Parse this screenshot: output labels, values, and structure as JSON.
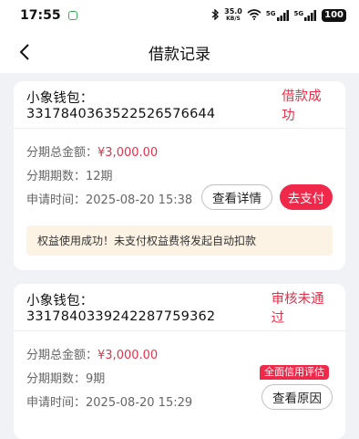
{
  "status_bar": {
    "time": "17:55",
    "net_speed_value": "35.0",
    "net_speed_unit": "KB/S",
    "signal_1": "5G",
    "signal_2": "5G",
    "battery": "100"
  },
  "nav": {
    "title": "借款记录"
  },
  "records": [
    {
      "title": "小象钱包：3317840363522526576644",
      "status": "借款成功",
      "total_label": "分期总金额：",
      "total_value": "¥3,000.00",
      "periods": "分期期数：12期",
      "apply_time": "申请时间：2025-08-20 15:38",
      "detail_button": "查看详情",
      "pay_button": "去支付",
      "notice": "权益使用成功！未支付权益费将发起自动扣款"
    },
    {
      "title": "小象钱包：3317840339242287759362",
      "status": "审核未通过",
      "total_label": "分期总金额：",
      "total_value": "¥3,000.00",
      "periods": "分期期数：9期",
      "apply_time": "申请时间：2025-08-20 15:29",
      "badge": "全面信用评估",
      "reason_button": "查看原因"
    }
  ],
  "colors": {
    "accent": "#f0284a",
    "status_text": "#e8304a",
    "notice_bg": "#fdf3e5",
    "page_bg": "#f1f2f6"
  }
}
